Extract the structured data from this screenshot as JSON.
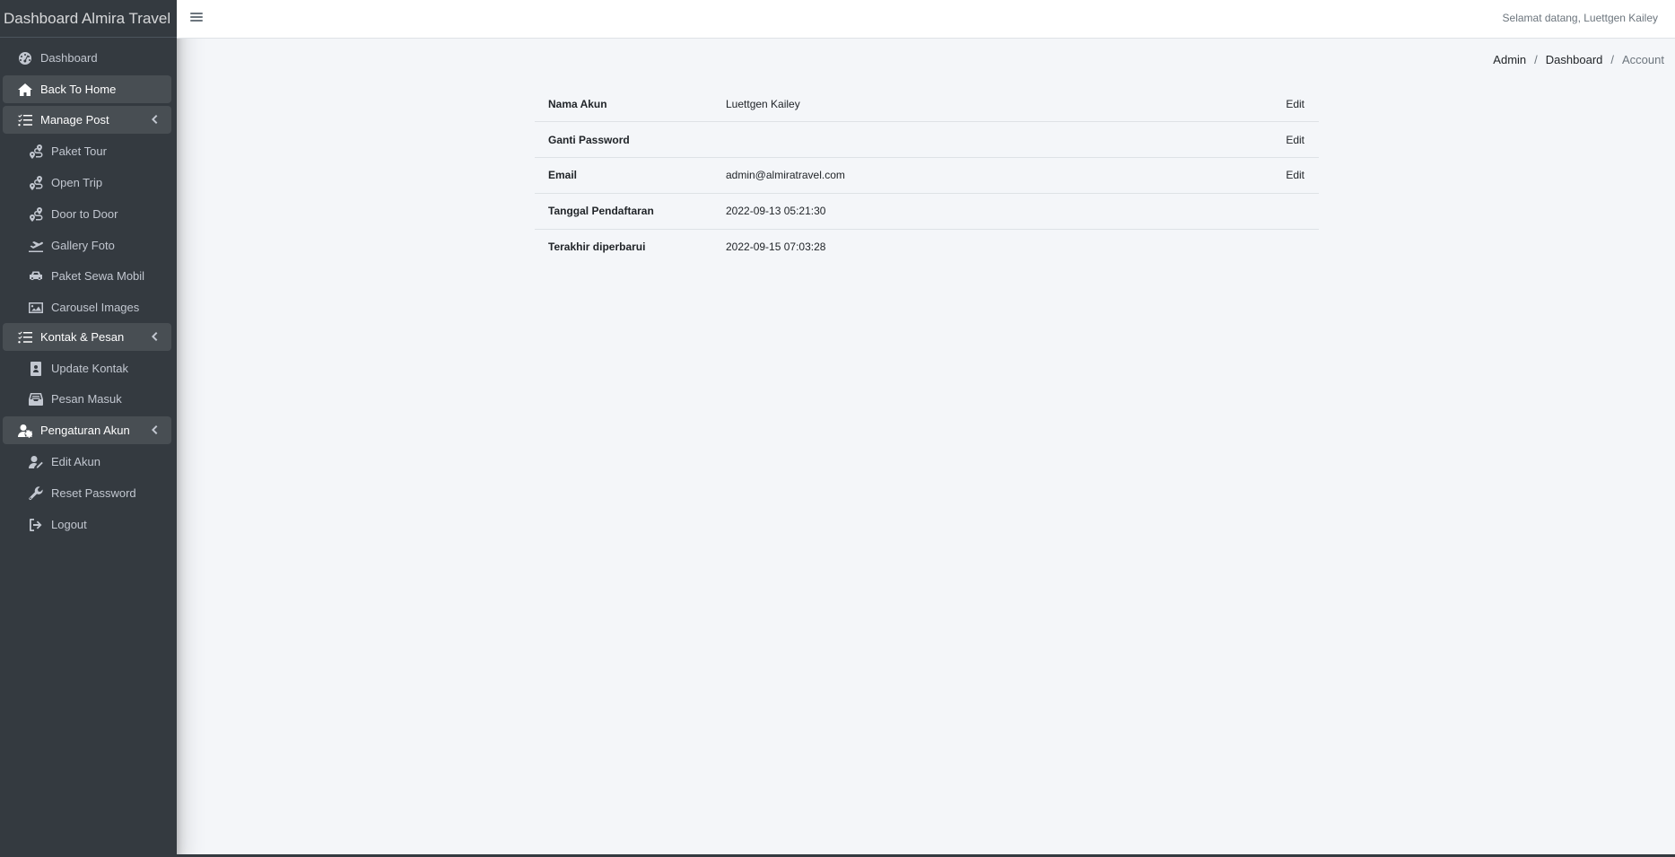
{
  "app": {
    "brand": "Dashboard Almira Travel",
    "welcome": "Selamat datang, Luettgen Kailey"
  },
  "sidebar": {
    "items": [
      {
        "label": "Dashboard",
        "icon": "tachometer-icon",
        "level": "top"
      },
      {
        "label": "Back To Home",
        "icon": "home-icon",
        "level": "top",
        "active": true
      },
      {
        "label": "Manage Post",
        "icon": "tasks-icon",
        "level": "top",
        "active": true,
        "expandable": true
      },
      {
        "label": "Paket Tour",
        "icon": "route-icon",
        "level": "sub"
      },
      {
        "label": "Open Trip",
        "icon": "route-icon",
        "level": "sub"
      },
      {
        "label": "Door to Door",
        "icon": "route-icon",
        "level": "sub"
      },
      {
        "label": "Gallery Foto",
        "icon": "plane-departure-icon",
        "level": "sub"
      },
      {
        "label": "Paket Sewa Mobil",
        "icon": "car-icon",
        "level": "sub"
      },
      {
        "label": "Carousel Images",
        "icon": "image-icon",
        "level": "sub"
      },
      {
        "label": "Kontak & Pesan",
        "icon": "tasks-icon",
        "level": "top",
        "active": true,
        "expandable": true
      },
      {
        "label": "Update Kontak",
        "icon": "address-book-icon",
        "level": "sub"
      },
      {
        "label": "Pesan Masuk",
        "icon": "inbox-icon",
        "level": "sub"
      },
      {
        "label": "Pengaturan Akun",
        "icon": "user-cog-icon",
        "level": "top",
        "active": true,
        "expandable": true
      },
      {
        "label": "Edit Akun",
        "icon": "user-edit-icon",
        "level": "sub"
      },
      {
        "label": "Reset Password",
        "icon": "wrench-icon",
        "level": "sub"
      },
      {
        "label": "Logout",
        "icon": "sign-out-icon",
        "level": "sub"
      }
    ]
  },
  "breadcrumb": {
    "items": [
      "Admin",
      "Dashboard"
    ],
    "current": "Account"
  },
  "account": {
    "rows": [
      {
        "label": "Nama Akun",
        "value": "Luettgen Kailey",
        "action": "Edit"
      },
      {
        "label": "Ganti Password",
        "value": "",
        "action": "Edit"
      },
      {
        "label": "Email",
        "value": "admin@almiratravel.com",
        "action": "Edit"
      },
      {
        "label": "Tanggal Pendaftaran",
        "value": "2022-09-13 05:21:30",
        "action": ""
      },
      {
        "label": "Terakhir diperbarui",
        "value": "2022-09-15 07:03:28",
        "action": ""
      }
    ]
  },
  "colors": {
    "sidebar_bg": "#343a40",
    "sidebar_text": "#c2c7d0",
    "content_bg": "#f4f6f9",
    "active_bg": "#494e53"
  }
}
